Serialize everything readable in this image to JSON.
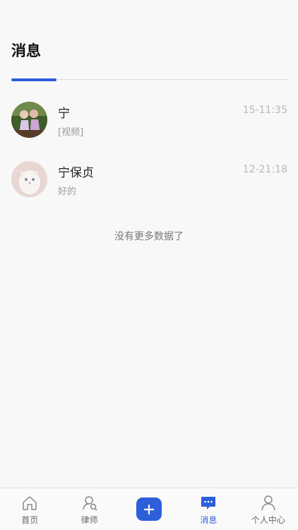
{
  "header": {
    "title": "消息"
  },
  "conversations": [
    {
      "name": "宁",
      "preview": "[视频]",
      "time": "15-11:35"
    },
    {
      "name": "宁保贞",
      "preview": "好的",
      "time": "12-21:18"
    }
  ],
  "list_footer": "没有更多数据了",
  "tabbar": {
    "items": [
      {
        "label": "首页",
        "icon": "home-icon"
      },
      {
        "label": "律师",
        "icon": "lawyer-search-icon"
      },
      {
        "label": "",
        "icon": "plus-icon"
      },
      {
        "label": "消息",
        "icon": "message-icon",
        "active": true
      },
      {
        "label": "个人中心",
        "icon": "user-icon"
      }
    ]
  },
  "colors": {
    "accent": "#2d5fdb",
    "background": "#f8f8f8"
  }
}
